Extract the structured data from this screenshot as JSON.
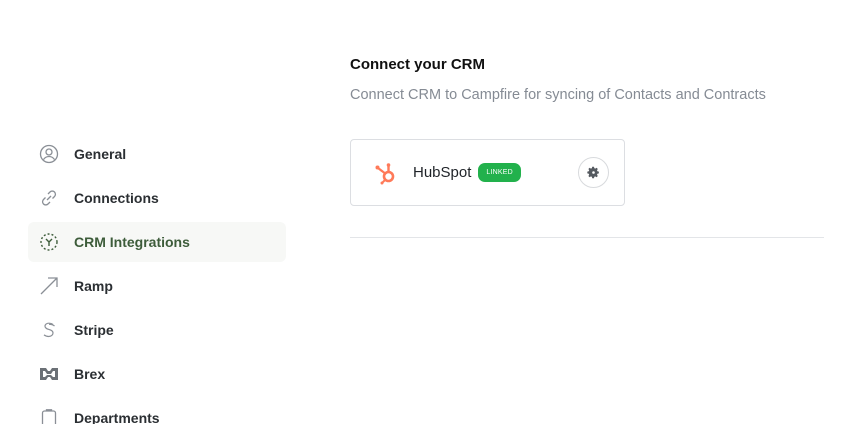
{
  "sidebar": {
    "items": [
      {
        "label": "General",
        "icon": "user-circle-icon"
      },
      {
        "label": "Connections",
        "icon": "link-icon"
      },
      {
        "label": "CRM Integrations",
        "icon": "crm-icon",
        "active": true
      },
      {
        "label": "Ramp",
        "icon": "ramp-icon"
      },
      {
        "label": "Stripe",
        "icon": "stripe-icon"
      },
      {
        "label": "Brex",
        "icon": "brex-icon"
      },
      {
        "label": "Departments",
        "icon": "clipboard-icon"
      }
    ]
  },
  "main": {
    "title": "Connect your CRM",
    "subtitle": "Connect CRM to Campfire for syncing of Contacts and Contracts",
    "integration": {
      "name": "HubSpot",
      "badge": "LINKED",
      "icon": "hubspot-icon",
      "settings_icon": "gear-icon"
    }
  },
  "colors": {
    "accent_green": "#22b14c",
    "hubspot_orange": "#ff7a59",
    "active_nav_text": "#3d5c3a"
  }
}
